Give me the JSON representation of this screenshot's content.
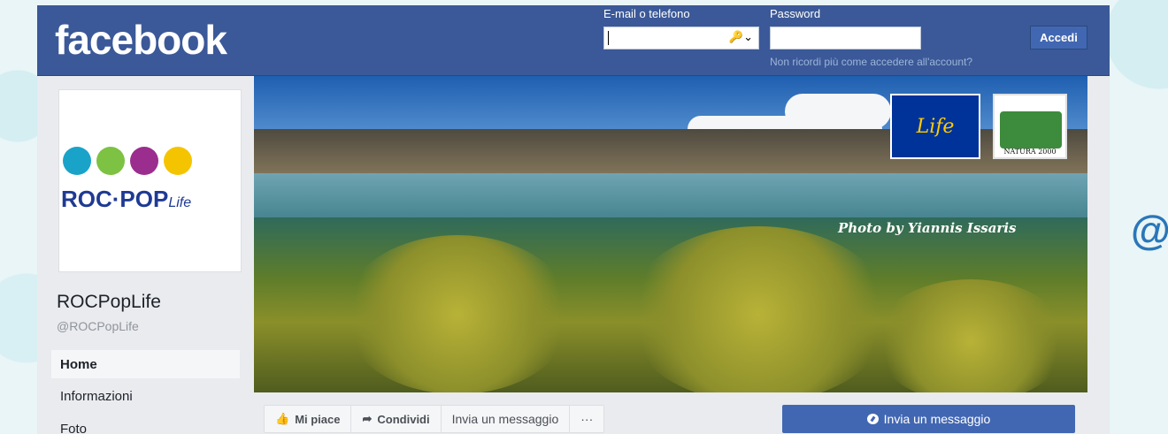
{
  "header": {
    "logo": "facebook",
    "email_label": "E-mail o telefono",
    "email_value": "",
    "password_label": "Password",
    "password_value": "",
    "forgot_link": "Non ricordi più come accedere all'account?",
    "login_button": "Accedi"
  },
  "page": {
    "name": "ROCPopLife",
    "handle": "@ROCPopLife",
    "avatar_brand": "ROC·POP",
    "avatar_brand_suffix": "Life"
  },
  "nav": {
    "items": [
      "Home",
      "Informazioni",
      "Foto"
    ],
    "active": "Home"
  },
  "cover": {
    "eu_logo_text": "Life",
    "natura_logo_text": "NATURA 2000",
    "photo_credit": "Photo by Yiannis Issaris"
  },
  "actions": {
    "like": "Mi piace",
    "share": "Condividi",
    "message": "Invia un messaggio",
    "more": "···",
    "primary_message": "Invia un messaggio"
  },
  "side_text": "@",
  "colors": {
    "fb_blue": "#3b5998",
    "button_blue": "#4267b2",
    "avatar_circles": [
      "#1aa3c9",
      "#7dc242",
      "#9b2d8f",
      "#f5c400"
    ]
  }
}
